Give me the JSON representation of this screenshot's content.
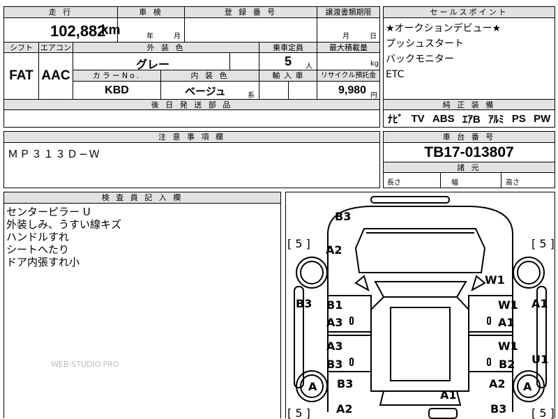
{
  "top": {
    "mileage_label": "走 行",
    "mileage_value": "102,882",
    "mileage_unit": "km",
    "inspection_label": "車 検",
    "inspection_year": "年",
    "inspection_month": "月",
    "reg_label": "登 録 番 号",
    "transfer_label": "譲渡書類期限",
    "transfer_month": "月",
    "transfer_day": "日",
    "shift_label": "シフト",
    "aircon_label": "エアコン",
    "color_label": "外 装 色",
    "capacity_label": "乗車定員",
    "loadmax_label": "最大積載量",
    "shift_value": "FAT",
    "aircon_value": "AAC",
    "color_value": "グレー",
    "capacity_value": "5",
    "capacity_unit": "人",
    "load_unit": "kg",
    "colorno_label": "カラーNo.",
    "interior_label": "内 装 色",
    "import_label": "輸 入 車",
    "recycle_label": "リサイクル預託金",
    "colorno_value": "KBD",
    "interior_value": "ベージュ",
    "interior_suffix": "系",
    "recycle_value": "9,980",
    "recycle_unit": "円",
    "later_parts_label": "後 日 発 送 部 品"
  },
  "selling_points": {
    "header": "セールスポイント",
    "items": [
      "★オークションデビュー★",
      "プッシュスタート",
      "バックモニター",
      "ETC"
    ]
  },
  "equipment": {
    "header": "純 正 装 備",
    "items": [
      "ﾅﾋﾞ",
      "TV",
      "ABS",
      "ｴｱB",
      "ｱﾙﾐ",
      "PS",
      "PW"
    ]
  },
  "notes": {
    "header": "注 意 事 項 欄",
    "text": "ＭＰ３１３Ｄ−Ｗ"
  },
  "chassis": {
    "header": "車 台 番 号",
    "value": "TB17-013807",
    "dims_header": "諸 元",
    "length_label": "長さ",
    "width_label": "幅",
    "height_label": "高さ"
  },
  "inspector": {
    "header": "検 査 員 記 入 欄",
    "lines": [
      "センターピラー U",
      "外装しみ、うすい線キズ",
      "ハンドルすれ",
      "シートへたり",
      "ドア内張すれ小"
    ],
    "watermark": "WEB-STUDIO.PRO"
  },
  "diagram": {
    "tire_marks": [
      "[ 5 ]",
      "[ 5 ]",
      "[ 5 ]",
      "[ 5 ]"
    ],
    "damage_marks": [
      "B3",
      "A2",
      "W1",
      "B3",
      "B1",
      "A3",
      "W1",
      "A1",
      "A1",
      "A3",
      "W1",
      "B3",
      "B2",
      "U1",
      "A",
      "B3",
      "A2",
      "A",
      "A1",
      "A2",
      "B3"
    ]
  }
}
